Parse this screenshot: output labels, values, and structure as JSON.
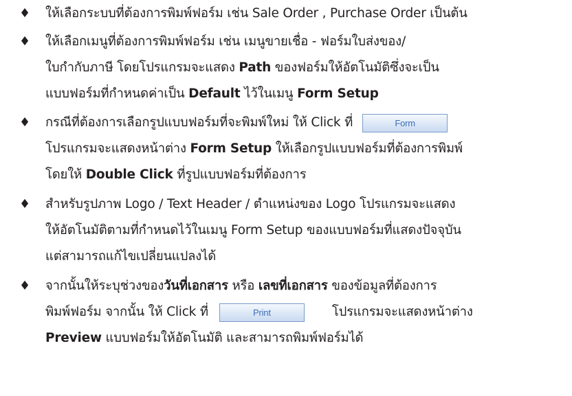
{
  "bullet_symbol": "♦",
  "items": [
    {
      "lines": [
        [
          "ให้เลือกระบบที่ต้องการพิมพ์ฟอร์ม เช่น Sale Order , Purchase Order เป็นต้น"
        ]
      ]
    },
    {
      "lines": [
        [
          "ให้เลือกเมนูที่ต้องการพิมพ์ฟอร์ม เช่น เมนูขายเชื่อ - ฟอร์มใบส่งของ/"
        ],
        [
          "ใบกำกับภาษี โดยโปรแกรมจะแสดง ",
          "Path",
          " ของฟอร์มให้อัตโนมัติซึ่งจะเป็น"
        ],
        [
          "แบบฟอร์มที่กำหนดค่าเป็น ",
          "Default",
          " ไว้ในเมนู ",
          "Form Setup"
        ]
      ]
    },
    {
      "lines": [
        [
          "กรณีที่ต้องการเลือกรูปแบบฟอร์มที่จะพิมพ์ใหม่ ให้ Click ที่"
        ],
        [
          "โปรแกรมจะแสดงหน้าต่าง ",
          "Form Setup",
          " ให้เลือกรูปแบบฟอร์มที่ต้องการพิมพ์"
        ],
        [
          "โดยให้ ",
          "Double Click",
          " ที่รูปแบบฟอร์มที่ต้องการ"
        ]
      ],
      "button_label": "Form"
    },
    {
      "lines": [
        [
          "สำหรับรูปภาพ Logo / Text Header / ตำแหน่งของ Logo โปรแกรมจะแสดง"
        ],
        [
          "ให้อัตโนมัติตามที่กำหนดไว้ในเมนู Form Setup ของแบบฟอร์มที่แสดงปัจจุบัน"
        ],
        [
          "แต่สามารถแก้ไขเปลี่ยนแปลงได้"
        ]
      ]
    },
    {
      "lines": [
        [
          "จากนั้นให้ระบุช่วงของ",
          "วันที่เอกสาร",
          " หรือ ",
          "เลขที่เอกสาร",
          " ของข้อมูลที่ต้องการ"
        ],
        [
          "พิมพ์ฟอร์ม จากนั้น ให้ Click ที่",
          "โปรแกรมจะแสดงหน้าต่าง"
        ],
        [
          "Preview",
          " แบบฟอร์มให้อัตโนมัติ และสามารถพิมพ์ฟอร์มได้"
        ]
      ],
      "button_label": "Print"
    }
  ],
  "button_colors": {
    "border": "#7a9cc9",
    "text": "#3d6fb8"
  }
}
